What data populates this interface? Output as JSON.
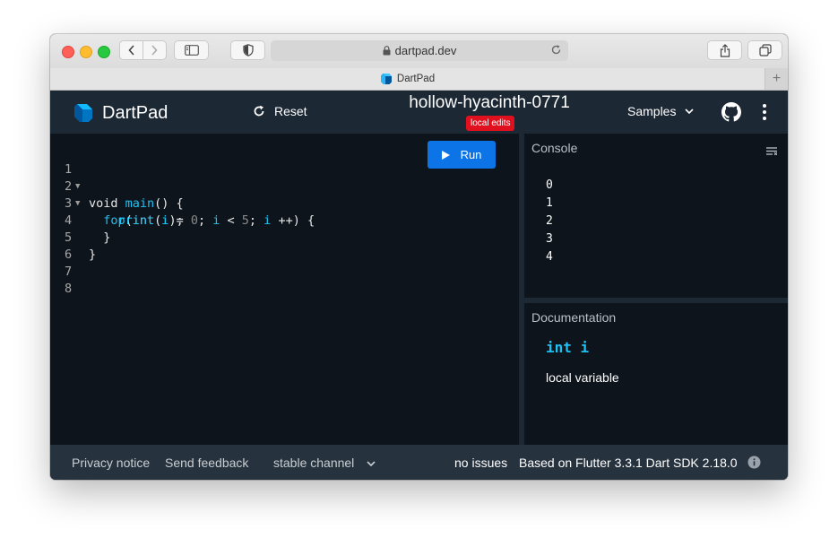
{
  "browser": {
    "url": "dartpad.dev",
    "tab_title": "DartPad",
    "new_tab_symbol": "+"
  },
  "header": {
    "app_name": "DartPad",
    "reset_label": "Reset",
    "pad_title": "hollow-hyacinth-0771",
    "badge": "local edits",
    "samples_label": "Samples"
  },
  "editor": {
    "run_label": "Run",
    "line_numbers": [
      "1",
      "2",
      "3",
      "4",
      "5",
      "6",
      "7",
      "8"
    ]
  },
  "console": {
    "title": "Console",
    "output": [
      "0",
      "1",
      "2",
      "3",
      "4"
    ]
  },
  "docs": {
    "title": "Documentation",
    "signature": "int i",
    "description": "local variable"
  },
  "footer": {
    "privacy": "Privacy notice",
    "feedback": "Send feedback",
    "channel": "stable channel",
    "issues": "no issues",
    "version": "Based on Flutter 3.3.1 Dart SDK 2.18.0"
  },
  "colors": {
    "accent": "#0d74e8",
    "keyword": "#1bc3f5",
    "badge": "#e0101e",
    "editor_bg": "#0e141c",
    "header_bg": "#1c2834"
  }
}
